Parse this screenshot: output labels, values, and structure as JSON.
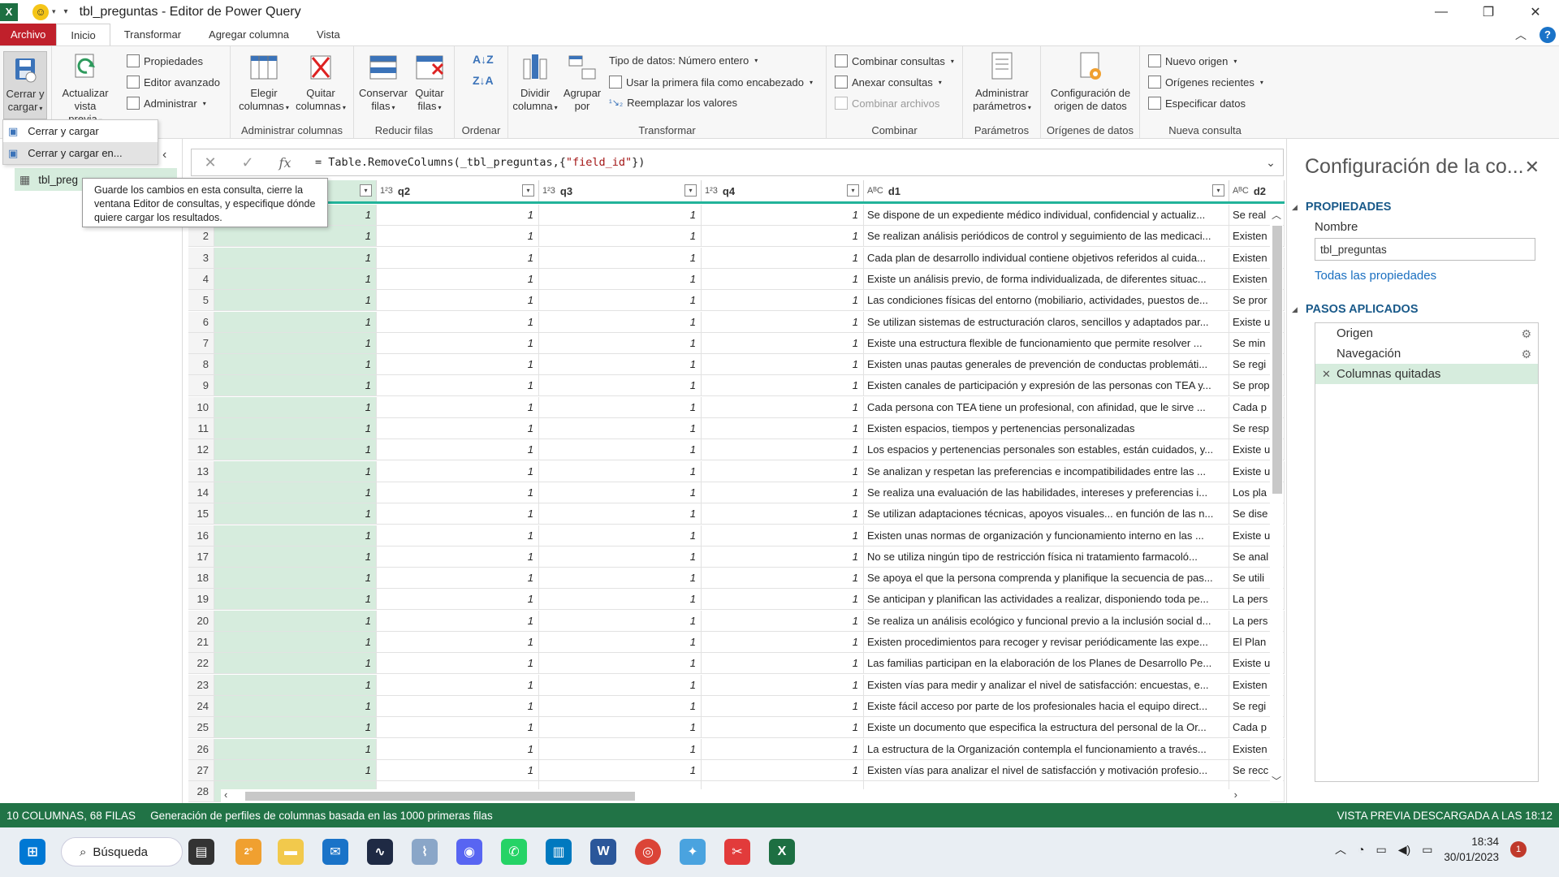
{
  "window": {
    "title": "tbl_preguntas - Editor de Power Query",
    "app_logo": "X"
  },
  "tabs": [
    "Archivo",
    "Inicio",
    "Transformar",
    "Agregar columna",
    "Vista"
  ],
  "ribbon": {
    "close_load": {
      "label_line1": "Cerrar y",
      "label_line2": "cargar",
      "group": "Cerrar"
    },
    "refresh": {
      "label_line1": "Actualizar",
      "label_line2": "vista previa"
    },
    "properties": "Propiedades",
    "advanced_editor": "Editor avanzado",
    "manage": "Administrar",
    "query_group_tail": "a",
    "choose_columns": {
      "label_line1": "Elegir",
      "label_line2": "columnas"
    },
    "remove_columns": {
      "label_line1": "Quitar",
      "label_line2": "columnas"
    },
    "manage_columns_group": "Administrar columnas",
    "keep_rows": {
      "label_line1": "Conservar",
      "label_line2": "filas"
    },
    "remove_rows": {
      "label_line1": "Quitar",
      "label_line2": "filas"
    },
    "reduce_rows_group": "Reducir filas",
    "sort_group": "Ordenar",
    "split_column": {
      "label_line1": "Dividir",
      "label_line2": "columna"
    },
    "group_by": {
      "label_line1": "Agrupar",
      "label_line2": "por"
    },
    "data_type": "Tipo de datos: Número entero",
    "first_row_header": "Usar la primera fila como encabezado",
    "replace_values": "Reemplazar los valores",
    "transform_group": "Transformar",
    "merge_queries": "Combinar consultas",
    "append_queries": "Anexar consultas",
    "combine_files": "Combinar archivos",
    "combine_group": "Combinar",
    "manage_params": {
      "label_line1": "Administrar",
      "label_line2": "parámetros"
    },
    "params_group": "Parámetros",
    "data_source_settings": {
      "label_line1": "Configuración de",
      "label_line2": "origen de datos"
    },
    "data_sources_group": "Orígenes de datos",
    "new_source": "Nuevo origen",
    "recent_sources": "Orígenes recientes",
    "enter_data": "Especificar datos",
    "new_query_group": "Nueva consulta"
  },
  "close_menu": {
    "items": [
      "Cerrar y cargar",
      "Cerrar y cargar en..."
    ]
  },
  "tooltip": "Guarde los cambios en esta consulta, cierre la ventana Editor de consultas, y especifique dónde quiere cargar los resultados.",
  "queries": {
    "item": "tbl_preg"
  },
  "formula": {
    "prefix": "= Table.RemoveColumns(_tbl_preguntas,{",
    "string": "\"field_id\"",
    "suffix": "})"
  },
  "columns": [
    {
      "type": "",
      "name": ""
    },
    {
      "type": "1²3",
      "name": "q2"
    },
    {
      "type": "1²3",
      "name": "q3"
    },
    {
      "type": "1²3",
      "name": "q4"
    },
    {
      "type": "AᴮC",
      "name": "d1"
    },
    {
      "type": "AᴮC",
      "name": "d2"
    }
  ],
  "rows": [
    {
      "n": "1",
      "v": [
        "1",
        "1",
        "1",
        "1"
      ],
      "d1": "Se dispone de un expediente médico individual, confidencial y actualiz...",
      "d2": "Se real"
    },
    {
      "n": "2",
      "v": [
        "1",
        "1",
        "1",
        "1"
      ],
      "d1": "Se realizan análisis periódicos de control y seguimiento de las medicaci...",
      "d2": "Existen"
    },
    {
      "n": "3",
      "v": [
        "1",
        "1",
        "1",
        "1"
      ],
      "d1": "Cada plan de desarrollo individual contiene objetivos referidos al cuida...",
      "d2": "Existen"
    },
    {
      "n": "4",
      "v": [
        "1",
        "1",
        "1",
        "1"
      ],
      "d1": "Existe un análisis previo, de forma individualizada, de diferentes situac...",
      "d2": "Existen"
    },
    {
      "n": "5",
      "v": [
        "1",
        "1",
        "1",
        "1"
      ],
      "d1": "Las condiciones físicas del entorno (mobiliario, actividades, puestos de...",
      "d2": "Se pror"
    },
    {
      "n": "6",
      "v": [
        "1",
        "1",
        "1",
        "1"
      ],
      "d1": "Se utilizan sistemas de estructuración claros, sencillos y adaptados par...",
      "d2": "Existe u"
    },
    {
      "n": "7",
      "v": [
        "1",
        "1",
        "1",
        "1"
      ],
      "d1": "Existe una estructura flexible de funcionamiento que permite resolver ...",
      "d2": "Se min"
    },
    {
      "n": "8",
      "v": [
        "1",
        "1",
        "1",
        "1"
      ],
      "d1": "Existen unas pautas generales de prevención de conductas problemáti...",
      "d2": "Se regi"
    },
    {
      "n": "9",
      "v": [
        "1",
        "1",
        "1",
        "1"
      ],
      "d1": "Existen canales de participación y expresión de las personas con TEA y...",
      "d2": "Se prop"
    },
    {
      "n": "10",
      "v": [
        "1",
        "1",
        "1",
        "1"
      ],
      "d1": "Cada persona con TEA tiene un profesional, con afinidad, que le sirve ...",
      "d2": "Cada p"
    },
    {
      "n": "11",
      "v": [
        "1",
        "1",
        "1",
        "1"
      ],
      "d1": "Existen espacios, tiempos y pertenencias personalizadas",
      "d2": "Se resp"
    },
    {
      "n": "12",
      "v": [
        "1",
        "1",
        "1",
        "1"
      ],
      "d1": "Los espacios y pertenencias personales son estables, están cuidados, y...",
      "d2": "Existe u"
    },
    {
      "n": "13",
      "v": [
        "1",
        "1",
        "1",
        "1"
      ],
      "d1": "Se analizan y respetan las preferencias e incompatibilidades entre las ...",
      "d2": "Existe u"
    },
    {
      "n": "14",
      "v": [
        "1",
        "1",
        "1",
        "1"
      ],
      "d1": "Se realiza una evaluación de las habilidades, intereses y preferencias i...",
      "d2": "Los pla"
    },
    {
      "n": "15",
      "v": [
        "1",
        "1",
        "1",
        "1"
      ],
      "d1": "Se utilizan adaptaciones técnicas, apoyos visuales... en función de las n...",
      "d2": "Se dise"
    },
    {
      "n": "16",
      "v": [
        "1",
        "1",
        "1",
        "1"
      ],
      "d1": "Existen unas normas de organización y funcionamiento interno en las ...",
      "d2": "Existe u"
    },
    {
      "n": "17",
      "v": [
        "1",
        "1",
        "1",
        "1"
      ],
      "d1": "No se utiliza ningún tipo de restricción física ni tratamiento farmacoló...",
      "d2": "Se anal"
    },
    {
      "n": "18",
      "v": [
        "1",
        "1",
        "1",
        "1"
      ],
      "d1": "Se apoya el que la persona comprenda y planifique la secuencia de pas...",
      "d2": "Se utili"
    },
    {
      "n": "19",
      "v": [
        "1",
        "1",
        "1",
        "1"
      ],
      "d1": "Se anticipan y planifican las actividades a realizar, disponiendo toda pe...",
      "d2": "La pers"
    },
    {
      "n": "20",
      "v": [
        "1",
        "1",
        "1",
        "1"
      ],
      "d1": "Se realiza un análisis ecológico y funcional previo a la inclusión social d...",
      "d2": "La pers"
    },
    {
      "n": "21",
      "v": [
        "1",
        "1",
        "1",
        "1"
      ],
      "d1": "Existen procedimientos para recoger y revisar periódicamente las expe...",
      "d2": "El Plan"
    },
    {
      "n": "22",
      "v": [
        "1",
        "1",
        "1",
        "1"
      ],
      "d1": "Las familias participan en la elaboración de los Planes de Desarrollo Pe...",
      "d2": "Existe u"
    },
    {
      "n": "23",
      "v": [
        "1",
        "1",
        "1",
        "1"
      ],
      "d1": "Existen vías para medir y analizar el nivel de satisfacción: encuestas, e...",
      "d2": "Existen"
    },
    {
      "n": "24",
      "v": [
        "1",
        "1",
        "1",
        "1"
      ],
      "d1": "Existe fácil acceso por parte de los profesionales hacia el equipo direct...",
      "d2": "Se regi"
    },
    {
      "n": "25",
      "v": [
        "1",
        "1",
        "1",
        "1"
      ],
      "d1": "Existe un documento que especifica la estructura del personal de la Or...",
      "d2": "Cada p"
    },
    {
      "n": "26",
      "v": [
        "1",
        "1",
        "1",
        "1"
      ],
      "d1": "La estructura de la Organización contempla el funcionamiento a través...",
      "d2": "Existen"
    },
    {
      "n": "27",
      "v": [
        "1",
        "1",
        "1",
        "1"
      ],
      "d1": "Existen vías para analizar el nivel de satisfacción y motivación profesio...",
      "d2": "Se recc"
    },
    {
      "n": "28",
      "v": [
        "",
        "",
        "",
        ""
      ],
      "d1": "",
      "d2": ""
    }
  ],
  "settings": {
    "title": "Configuración de la co...",
    "properties_header": "PROPIEDADES",
    "name_label": "Nombre",
    "name_value": "tbl_preguntas",
    "all_properties": "Todas las propiedades",
    "steps_header": "PASOS APLICADOS",
    "steps": [
      "Origen",
      "Navegación",
      "Columnas quitadas"
    ]
  },
  "status": {
    "counts": "10 COLUMNAS, 68 FILAS",
    "profiling": "Generación de perfiles de columnas basada en las 1000 primeras filas",
    "preview": "VISTA PREVIA DESCARGADA A LAS 18:12"
  },
  "taskbar": {
    "search": "Búsqueda",
    "weather": "2°",
    "time": "18:34",
    "date": "30/01/2023",
    "notifications": "1"
  },
  "colors": {
    "excel_green": "#217346",
    "file_tab_red": "#c0202b",
    "selected_green": "#d6ecdd",
    "header_underline": "#22b39a"
  }
}
